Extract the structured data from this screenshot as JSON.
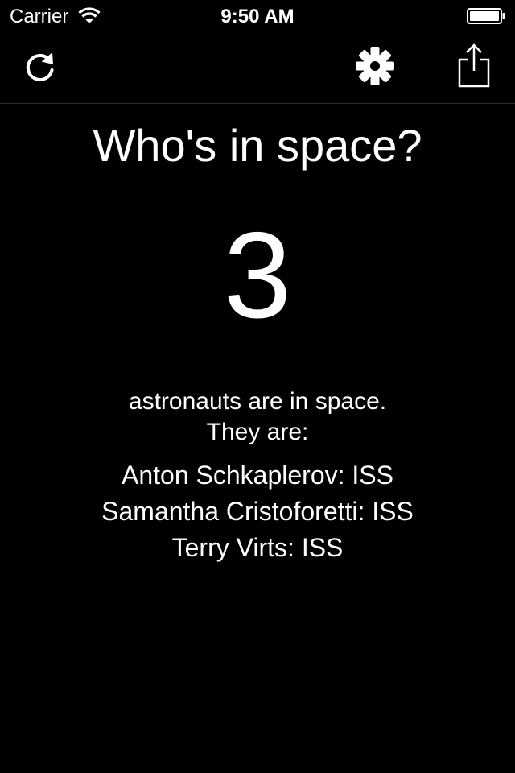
{
  "status_bar": {
    "carrier": "Carrier",
    "time": "9:50 AM"
  },
  "toolbar": {
    "icons": [
      "refresh-icon",
      "gear-icon",
      "share-icon"
    ]
  },
  "main": {
    "title": "Who's in space?",
    "count": "3",
    "subtitle_line1": "astronauts are in space.",
    "subtitle_line2": "They are:",
    "people": [
      "Anton Schkaplerov: ISS",
      "Samantha Cristoforetti: ISS",
      "Terry Virts: ISS"
    ]
  },
  "colors": {
    "background": "#000000",
    "foreground": "#ffffff"
  }
}
